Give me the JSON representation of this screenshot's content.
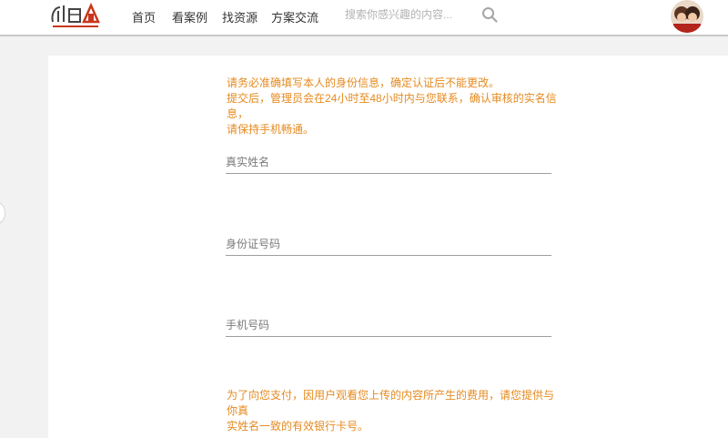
{
  "header": {
    "nav": [
      {
        "label": "首页"
      },
      {
        "label": "看案例"
      },
      {
        "label": "找资源"
      },
      {
        "label": "方案交流"
      }
    ],
    "search": {
      "placeholder": "搜索你感兴趣的内容..."
    }
  },
  "form": {
    "notice": {
      "line1": "请务必准确填写本人的身份信息，确定认证后不能更改。",
      "line2": "提交后，管理员会在24小时至48小时内与您联系，确认审核的实名信息，",
      "line3": "请保持手机畅通。"
    },
    "fields": {
      "real_name": {
        "placeholder": "真实姓名",
        "value": ""
      },
      "id_number": {
        "placeholder": "身份证号码",
        "value": ""
      },
      "phone": {
        "placeholder": "手机号码",
        "value": ""
      }
    },
    "payment_notice": {
      "line1": "为了向您支付，因用户观看您上传的内容所产生的费用，请您提供与你真",
      "line2": "实姓名一致的有效银行卡号。"
    }
  },
  "colors": {
    "accent": "#e58a1f",
    "logo_red": "#c8361d"
  }
}
